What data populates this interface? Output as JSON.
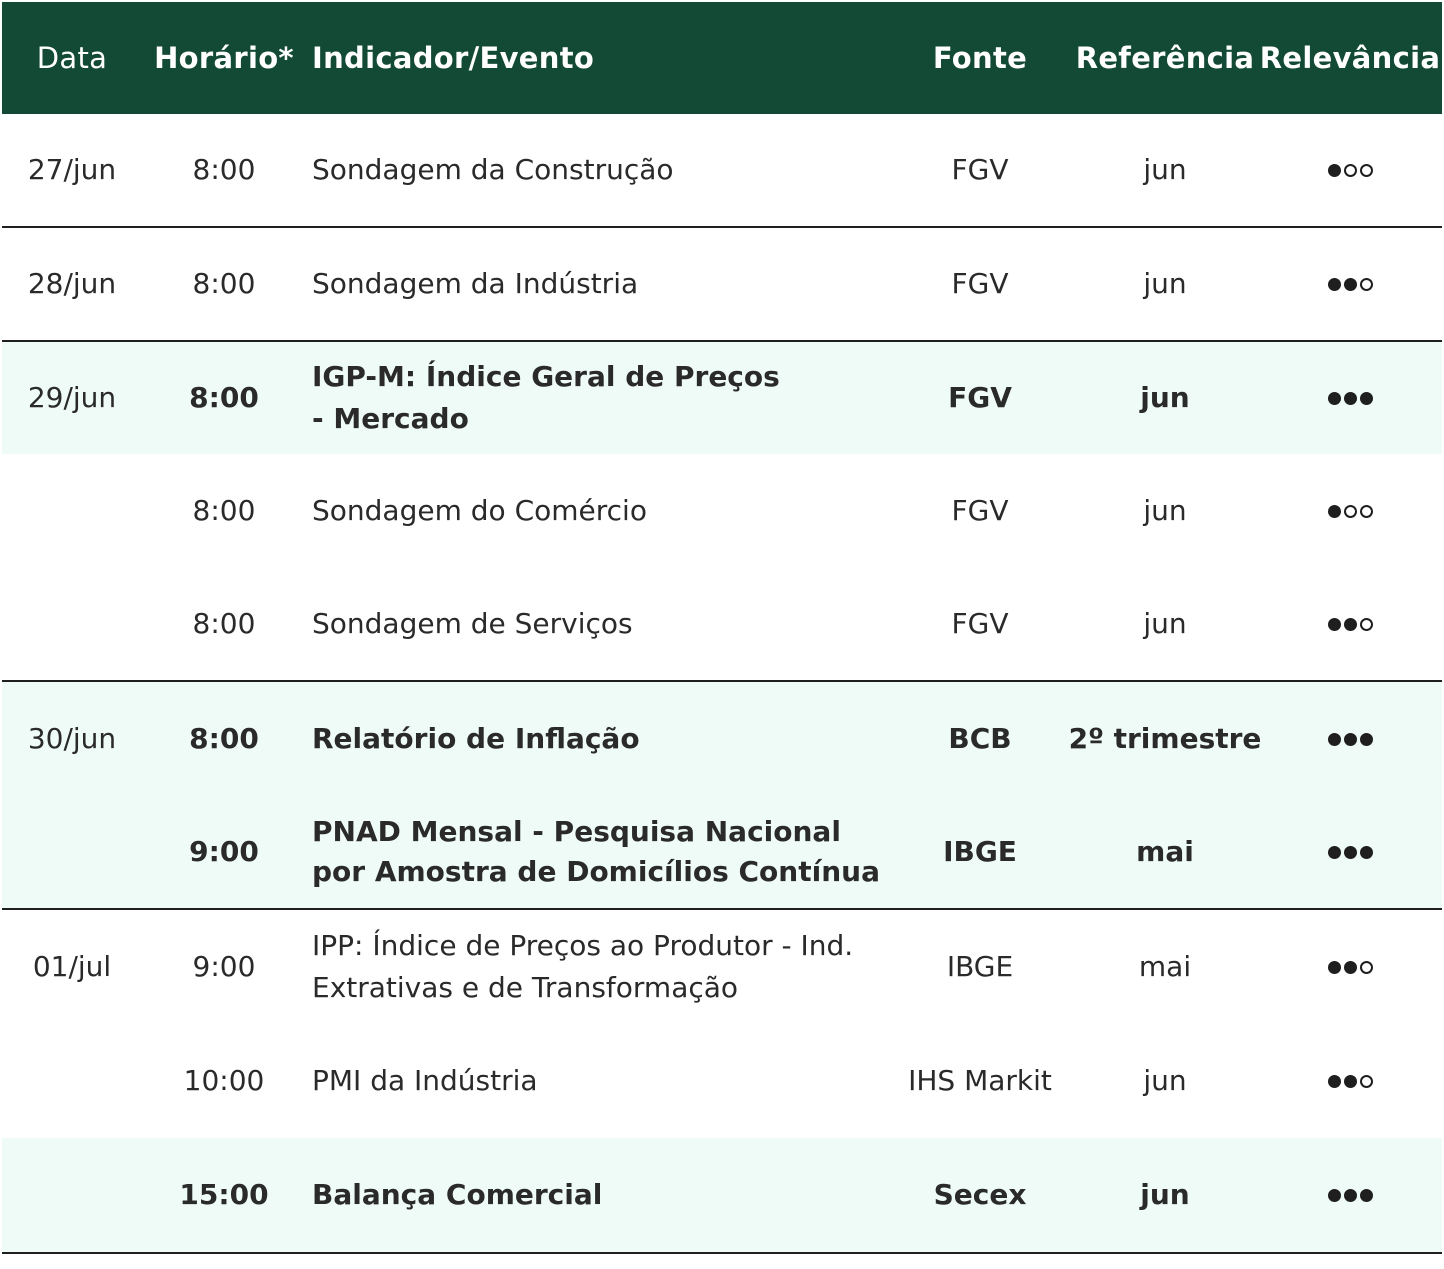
{
  "header": {
    "date": "Data",
    "time": "Horário*",
    "event": "Indicador/Evento",
    "source": "Fonte",
    "reference": "Referência",
    "relevance": "Relevância"
  },
  "colors": {
    "header_bg": "#134a35",
    "highlight_bg": "#effbf6",
    "text": "#2a2a2a"
  },
  "rows": [
    {
      "date": "27/jun",
      "time": "8:00",
      "event": "Sondagem da Construção",
      "source": "FGV",
      "reference": "jun",
      "relevance": 1
    },
    {
      "date": "28/jun",
      "time": "8:00",
      "event": "Sondagem da Indústria",
      "source": "FGV",
      "reference": "jun",
      "relevance": 2
    },
    {
      "date": "29/jun",
      "time": "8:00",
      "event": "IGP-M: Índice Geral de Preços - Mercado",
      "source": "FGV",
      "reference": "jun",
      "relevance": 3
    },
    {
      "date": "",
      "time": "8:00",
      "event": "Sondagem do Comércio",
      "source": "FGV",
      "reference": "jun",
      "relevance": 1
    },
    {
      "date": "",
      "time": "8:00",
      "event": "Sondagem de Serviços",
      "source": "FGV",
      "reference": "jun",
      "relevance": 2
    },
    {
      "date": "30/jun",
      "time": "8:00",
      "event": "Relatório de Inflação",
      "source": "BCB",
      "reference": "2º trimestre",
      "relevance": 3
    },
    {
      "date": "",
      "time": "9:00",
      "event": "PNAD Mensal - Pesquisa Nacional por Amostra de Domicílios Contínua",
      "source": "IBGE",
      "reference": "mai",
      "relevance": 3
    },
    {
      "date": "01/jul",
      "time": "9:00",
      "event": "IPP: Índice de Preços ao Produtor - Ind. Extrativas e de Transformação",
      "source": "IBGE",
      "reference": "mai",
      "relevance": 2
    },
    {
      "date": "",
      "time": "10:00",
      "event": "PMI da Indústria",
      "source": "IHS Markit",
      "reference": "jun",
      "relevance": 2
    },
    {
      "date": "",
      "time": "15:00",
      "event": "Balança Comercial",
      "source": "Secex",
      "reference": "jun",
      "relevance": 3
    }
  ]
}
